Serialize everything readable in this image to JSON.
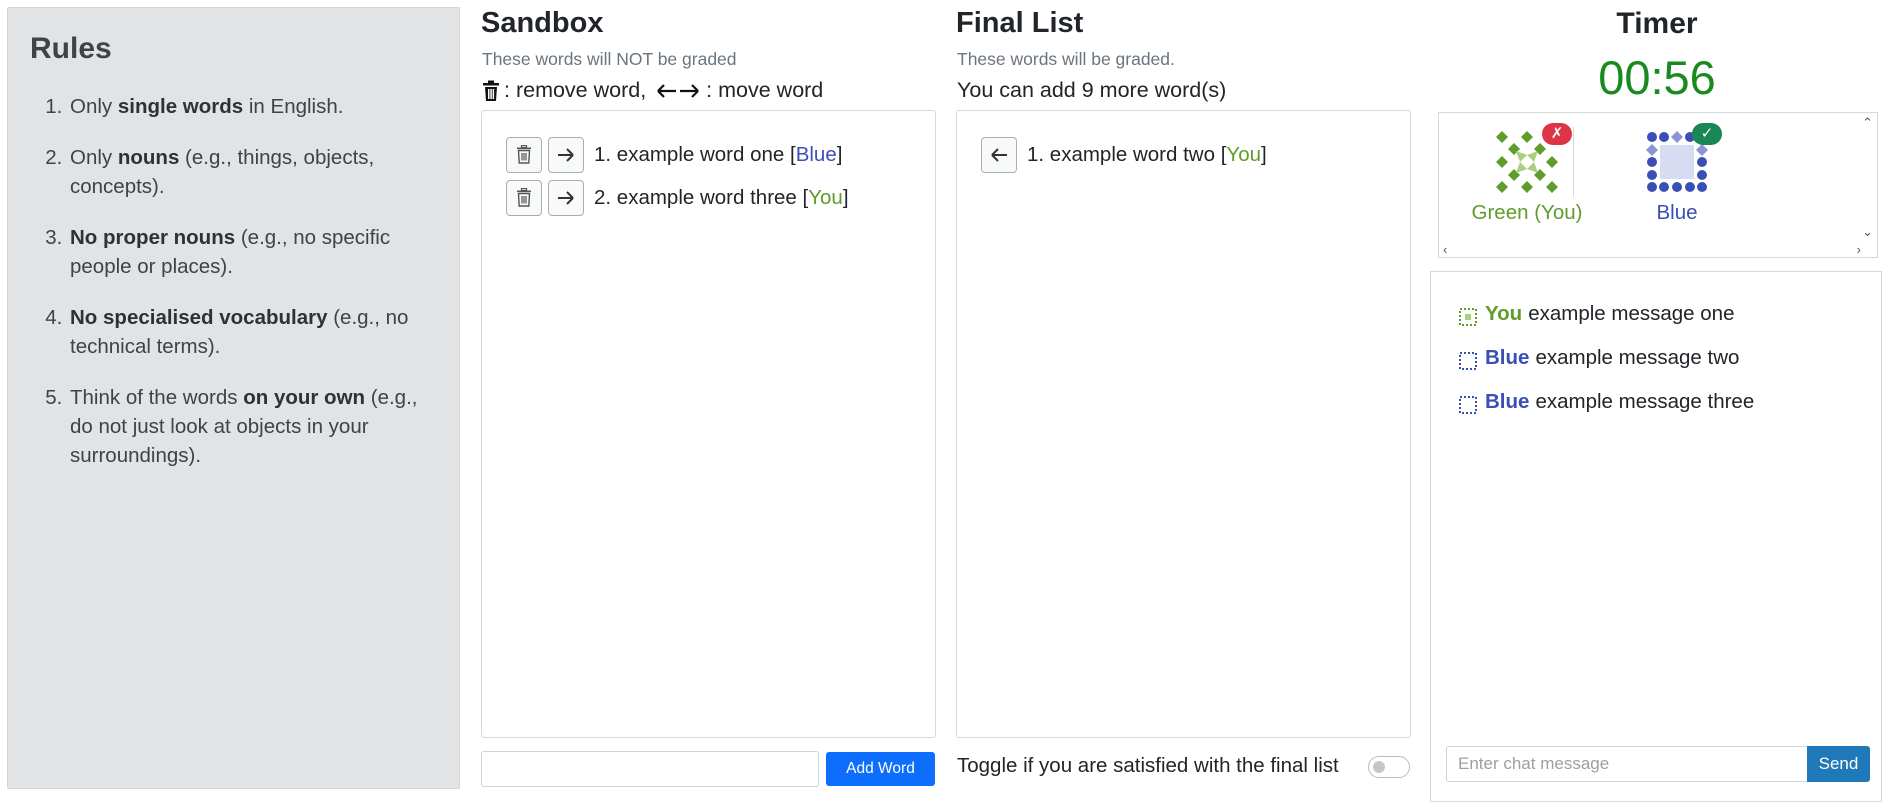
{
  "rules": {
    "title": "Rules",
    "items": [
      {
        "pre": "Only ",
        "bold": "single words",
        "post": " in English."
      },
      {
        "pre": "Only ",
        "bold": "nouns",
        "post": " (e.g., things, objects, concepts)."
      },
      {
        "pre": "",
        "bold": "No proper nouns",
        "post": " (e.g., no specific people or places)."
      },
      {
        "pre": "",
        "bold": "No specialised vocabulary",
        "post": " (e.g., no technical terms)."
      },
      {
        "pre": "Think of the words ",
        "bold": "on your own",
        "post": " (e.g., do not just look at objects in your surroundings)."
      }
    ]
  },
  "sandbox": {
    "title": "Sandbox",
    "subtitle": "These words will NOT be graded",
    "hint_remove": ": remove word, ",
    "hint_move": ": move word",
    "words": [
      {
        "text": "1. example word one [",
        "author": "Blue",
        "close": "]"
      },
      {
        "text": "2. example word three [",
        "author": "You",
        "close": "]"
      }
    ],
    "input_value": "",
    "add_button": "Add Word"
  },
  "final_list": {
    "title": "Final List",
    "subtitle": "These words will be graded.",
    "remaining": "You can add 9 more word(s)",
    "words": [
      {
        "text": "1. example word two [",
        "author": "You",
        "close": "]"
      }
    ],
    "toggle_label": "Toggle if you are satisfied with the final list",
    "toggle_on": false
  },
  "timer": {
    "title": "Timer",
    "value": "00:56"
  },
  "players": [
    {
      "name": "Green (You)",
      "color": "#5f9c2c",
      "status": "✗",
      "status_type": "fail"
    },
    {
      "name": "Blue",
      "color": "#3a4fb5",
      "status": "✓",
      "status_type": "ok"
    }
  ],
  "chat": {
    "messages": [
      {
        "author": "You",
        "color": "#5f9c2c",
        "text": "example message one"
      },
      {
        "author": "Blue",
        "color": "#3a4fb5",
        "text": "example message two"
      },
      {
        "author": "Blue",
        "color": "#3a4fb5",
        "text": "example message three"
      }
    ],
    "placeholder": "Enter chat message",
    "send_label": "Send"
  },
  "colors": {
    "green": "#5f9c2c",
    "blue": "#3a4fb5",
    "timer": "#198a1e",
    "primary_button": "#0d6efd",
    "send_button": "#1f78b7"
  }
}
